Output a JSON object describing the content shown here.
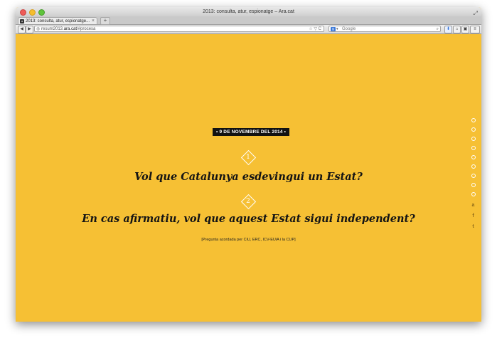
{
  "window": {
    "title": "2013: consulta, atur, espionatge – Ara.cat",
    "resize_glyph": "⤢"
  },
  "tabs": [
    {
      "label": "2013: consulta, atur, espionatge...",
      "close": "×"
    }
  ],
  "newtab_label": "+",
  "nav": {
    "back": "◀",
    "forward": "▶",
    "url_prefix": "resum2013.",
    "url_host": "ara.cat",
    "url_path": "/#procesa",
    "url_tools": "☆ ▽ C",
    "search_placeholder": "Google",
    "search_engine": "g",
    "download": "⬇",
    "home": "⌂",
    "sync": "▣",
    "menu": "≡"
  },
  "content": {
    "date": "• 9 DE NOVEMBRE DEL 2014 •",
    "questions": [
      {
        "number": "1",
        "text": "Vol que Catalunya esdevingui un Estat?"
      },
      {
        "number": "2",
        "text": "En cas afirmatiu, vol que aquest Estat sigui independent?"
      }
    ],
    "note": "[Pregunta acordada per CiU, ERC, ICV-EUiA i la CUP]"
  },
  "side_nav": {
    "dot_count": 9
  },
  "social": [
    {
      "name": "meneame",
      "glyph": "a"
    },
    {
      "name": "facebook",
      "glyph": "f"
    },
    {
      "name": "twitter",
      "glyph": "t"
    }
  ],
  "colors": {
    "background": "#f6c034",
    "badge": "#121212",
    "text": "#141414"
  }
}
